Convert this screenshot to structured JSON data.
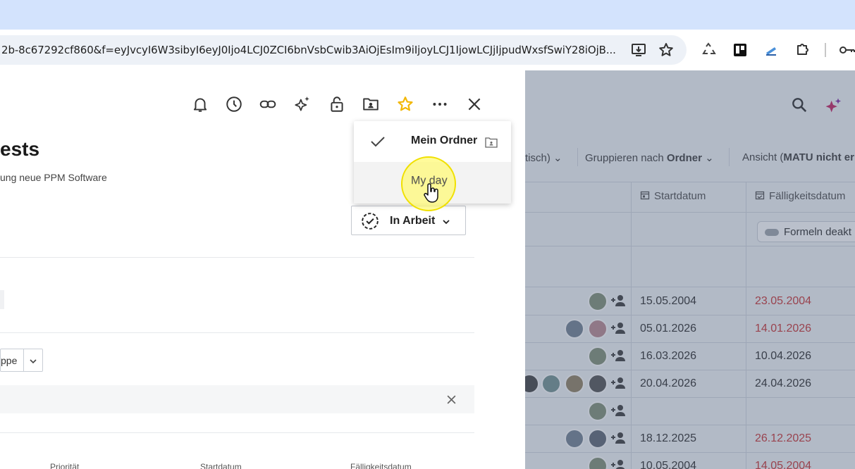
{
  "browser": {
    "url": "2b-8c67292cf860&f=eyJvcyI6W3sibyI6eyJ0Ijo4LCJ0ZCI6bnVsbCwib3AiOjEsIm9iIjoyLCJ1IjowLCJjIjpudWxsfSwiY28iOjB..."
  },
  "panel": {
    "title": "ests",
    "subtitle": "ung neue PPM Software",
    "status": "In Arbeit",
    "group_select": "ppe",
    "bottom_labels": [
      "Priorität",
      "Startdatum",
      "Fälligkeitsdatum"
    ]
  },
  "folder_dropdown": {
    "items": [
      {
        "label": "Mein Ordner",
        "checked": true
      },
      {
        "label": "My day",
        "checked": false
      }
    ]
  },
  "background": {
    "filter_1": "tisch)",
    "group_by_prefix": "Gruppieren nach ",
    "group_by_value": "Ordner",
    "view_prefix": "Ansicht (",
    "view_value": "MATU nicht er",
    "col_start": "Startdatum",
    "col_due": "Fälligkeitsdatum",
    "formula_toggle": "Formeln deakt",
    "rows": [
      {
        "start": "15.05.2004",
        "due": "23.05.2004",
        "overdue": true
      },
      {
        "start": "05.01.2026",
        "due": "14.01.2026",
        "overdue": true
      },
      {
        "start": "16.03.2026",
        "due": "10.04.2026",
        "overdue": false
      },
      {
        "start": "20.04.2026",
        "due": "24.04.2026",
        "overdue": false
      },
      {
        "start": "",
        "due": "",
        "overdue": false
      },
      {
        "start": "18.12.2025",
        "due": "26.12.2025",
        "overdue": true
      },
      {
        "start": "10.05.2004",
        "due": "14.05.2004",
        "overdue": true
      }
    ]
  },
  "colors": {
    "overdue": "#c62828",
    "star": "#f2b705",
    "highlight": "#fffa78"
  }
}
